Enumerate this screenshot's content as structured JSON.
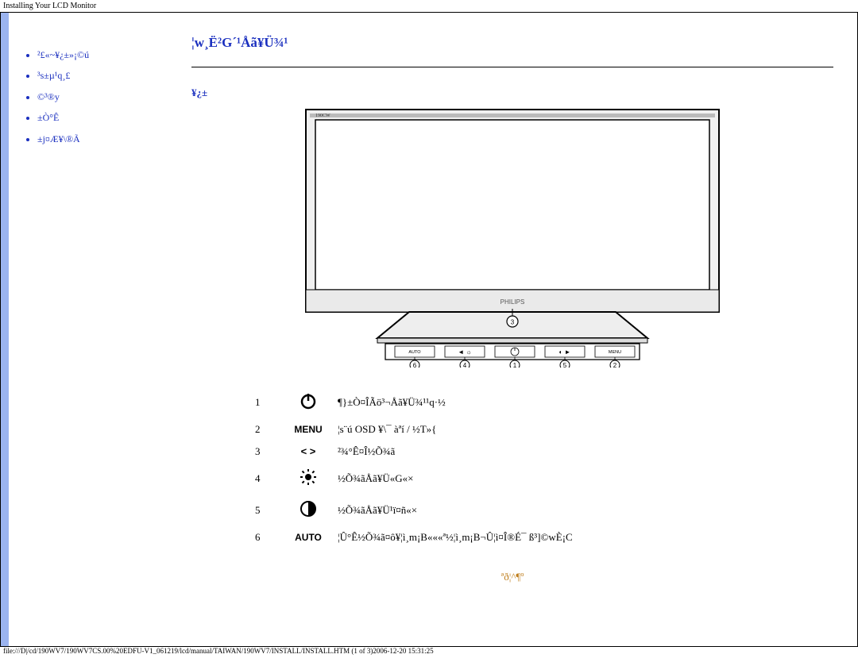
{
  "header_text": "Installing Your LCD Monitor",
  "sidebar": {
    "items": [
      {
        "label": "²£«~¥¿­±»¡©ú"
      },
      {
        "label": "³s±µ¹q¸£"
      },
      {
        "label": "©³®y"
      },
      {
        "label": "±Ò°Ê"
      },
      {
        "label": "±j¤Æ¥\\®Ã"
      }
    ]
  },
  "page_title": "¦w¸Ë²G´¹Åã¥Ü¾¹",
  "section_title": "¥¿­±",
  "buttons": {
    "rows": [
      {
        "num": "1",
        "icon": "power",
        "desc": "¶}±Ò¤ÎÃö³¬Åã¥Ü¾¹¹q·½"
      },
      {
        "num": "2",
        "icon": "menu",
        "desc": "¦s¨ú OSD ¥\\¯ àªí / ½T»{"
      },
      {
        "num": "3",
        "icon": "ltgt",
        "desc": "²¾°Ê¤Î½Õ¾ã"
      },
      {
        "num": "4",
        "icon": "brightness",
        "desc": "½Õ¾ãÅã¥Ü«G«×"
      },
      {
        "num": "5",
        "icon": "contrast",
        "desc": "½Õ¾ãÅã¥Ü¹ï¤ñ«×"
      },
      {
        "num": "6",
        "icon": "auto",
        "desc": "¦Û°Ê½Õ¾ã¤ô¥­¦ì¸m¡B«««ª½¦ì¸m¡B¬Û¦ì¤Î®É¯ ß³]©w­È¡C"
      }
    ],
    "icon_labels": {
      "menu": "MENU",
      "ltgt": "<  >",
      "auto": "AUTO"
    }
  },
  "top_link": "ªð¦^­¶­º",
  "footer_text": "file:///D|/cd/190WV7/190WV7CS.00%20EDFU-V1_061219/lcd/manual/TAIWAN/190WV7/INSTALL/INSTALL.HTM (1 of 3)2006-12-20 15:31:25"
}
